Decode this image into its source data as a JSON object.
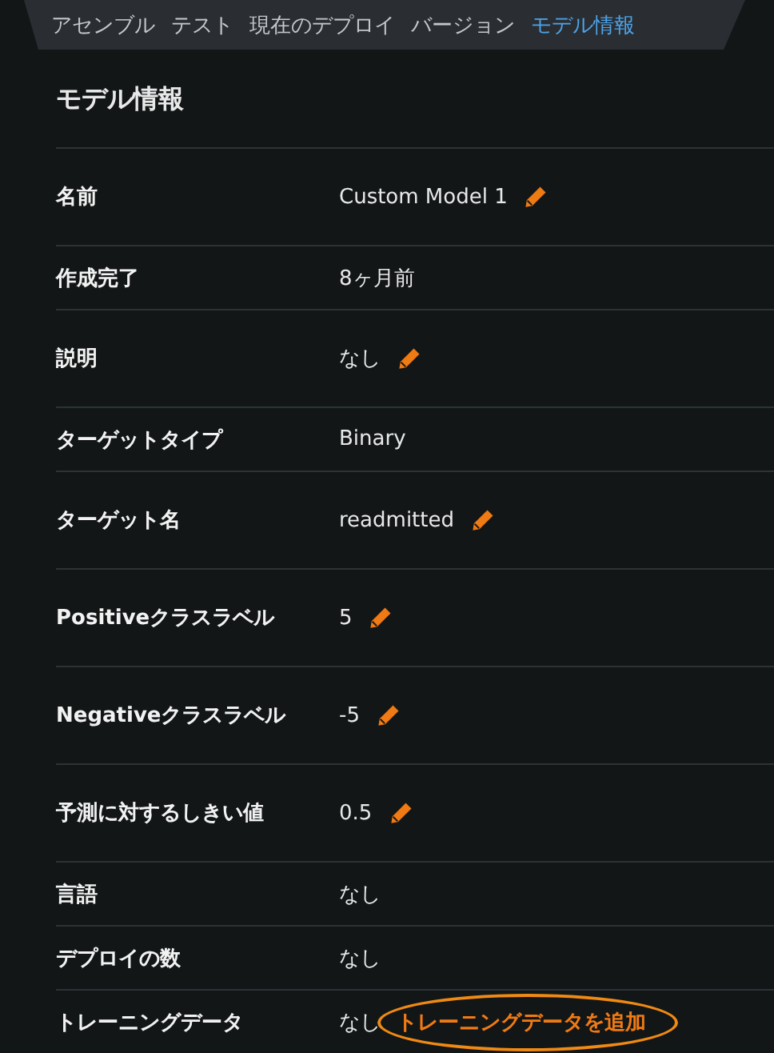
{
  "tabs": [
    {
      "label": "アセンブル",
      "selected": false
    },
    {
      "label": "テスト",
      "selected": false
    },
    {
      "label": "現在のデプロイ",
      "selected": false
    },
    {
      "label": "バージョン",
      "selected": false
    },
    {
      "label": "モデル情報",
      "selected": true
    }
  ],
  "heading": "モデル情報",
  "rows": [
    {
      "label": "名前",
      "value": "Custom Model 1",
      "editable": true
    },
    {
      "label": "作成完了",
      "value": "8ヶ月前",
      "editable": false
    },
    {
      "label": "説明",
      "value": "なし",
      "editable": true
    },
    {
      "label": "ターゲットタイプ",
      "value": "Binary",
      "editable": false
    },
    {
      "label": "ターゲット名",
      "value": "readmitted",
      "editable": true
    },
    {
      "label": "Positiveクラスラベル",
      "value": "5",
      "editable": true
    },
    {
      "label": "Negativeクラスラベル",
      "value": "-5",
      "editable": true
    },
    {
      "label": "予測に対するしきい値",
      "value": "0.5",
      "editable": true
    },
    {
      "label": "言語",
      "value": "なし",
      "editable": false
    },
    {
      "label": "デプロイの数",
      "value": "なし",
      "editable": false
    },
    {
      "label": "トレーニングデータ",
      "value": "なし",
      "editable": false,
      "link": "トレーニングデータを追加"
    }
  ]
}
